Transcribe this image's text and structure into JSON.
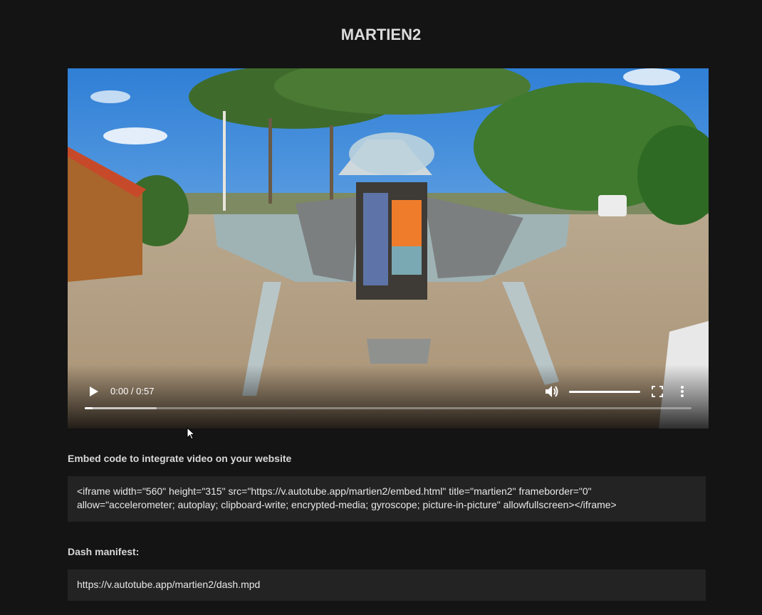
{
  "page": {
    "title": "MARTIEN2"
  },
  "player": {
    "time_display": "0:00 / 0:57",
    "progress_played": 0.013,
    "progress_buffered": 0.118,
    "volume": 1.0,
    "play_icon": "play-icon",
    "volume_icon": "volume-icon",
    "fullscreen_icon": "fullscreen-icon",
    "more_icon": "more-vertical-icon"
  },
  "embed": {
    "label": "Embed code to integrate video on your website",
    "code_line1": "<iframe width=\"560\" height=\"315\" src=\"https://v.autotube.app/martien2/embed.html\" title=\"martien2\" frameborder=\"0\"",
    "code_line2": "allow=\"accelerometer; autoplay; clipboard-write; encrypted-media; gyroscope; picture-in-picture\" allowfullscreen></iframe>"
  },
  "dash": {
    "label": "Dash manifest:",
    "url": "https://v.autotube.app/martien2/dash.mpd"
  },
  "colors": {
    "background": "#141414",
    "code_box": "#232323",
    "text": "#e6e6e6"
  }
}
